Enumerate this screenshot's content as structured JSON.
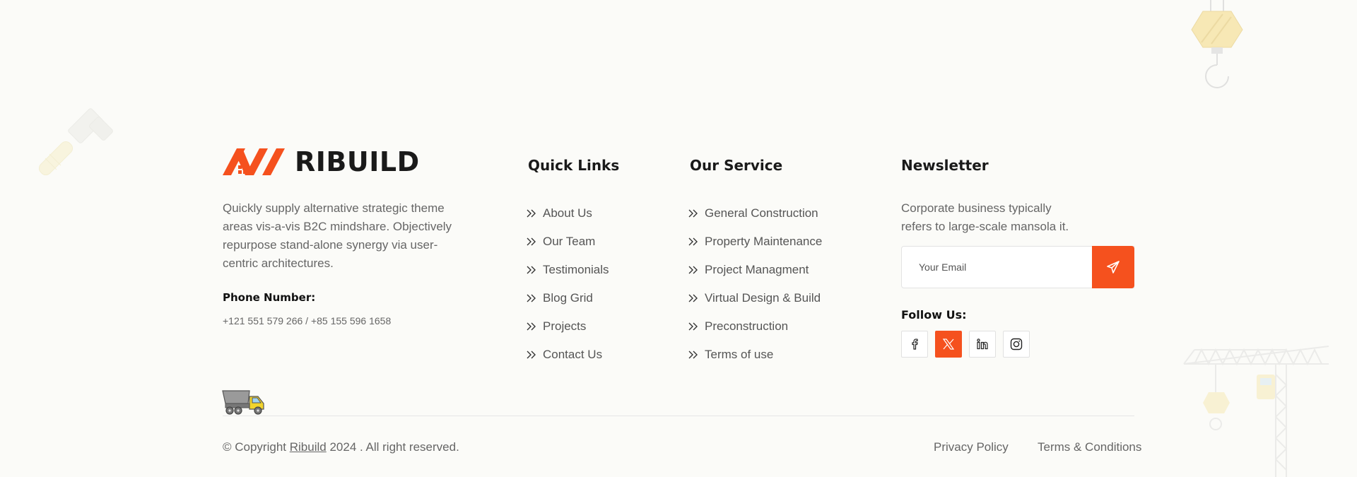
{
  "brand": {
    "name": "RIBUILD",
    "accent": "#f5511e",
    "dark": "#1a1a1a"
  },
  "about": {
    "text": "Quickly supply alternative strategic theme areas vis-a-vis B2C mindshare. Objectively repurpose stand-alone synergy via user-centric architectures.",
    "phone_label": "Phone Number:",
    "phone_value": "+121 551 579 266 / +85 155 596 1658"
  },
  "quick_links": {
    "title": "Quick Links",
    "items": [
      {
        "label": "About Us"
      },
      {
        "label": "Our Team"
      },
      {
        "label": "Testimonials"
      },
      {
        "label": "Blog Grid"
      },
      {
        "label": "Projects"
      },
      {
        "label": "Contact Us"
      }
    ]
  },
  "services": {
    "title": "Our Service",
    "items": [
      {
        "label": "General Construction"
      },
      {
        "label": "Property Maintenance"
      },
      {
        "label": "Project Managment"
      },
      {
        "label": "Virtual Design & Build"
      },
      {
        "label": "Preconstruction"
      },
      {
        "label": "Terms of use"
      }
    ]
  },
  "newsletter": {
    "title": "Newsletter",
    "text": "Corporate business typically refers to large-scale mansola it.",
    "email_placeholder": "Your Email",
    "submit_icon": "send-icon",
    "follow_label": "Follow Us:",
    "socials": [
      {
        "icon": "facebook-icon",
        "active": false
      },
      {
        "icon": "x-twitter-icon",
        "active": true
      },
      {
        "icon": "linkedin-icon",
        "active": false
      },
      {
        "icon": "instagram-icon",
        "active": false
      }
    ]
  },
  "footer": {
    "copyright_prefix": "© Copyright",
    "copyright_brand": "Ribuild",
    "copyright_suffix": "2024 . All right reserved.",
    "privacy": "Privacy Policy",
    "terms": "Terms & Conditions"
  }
}
